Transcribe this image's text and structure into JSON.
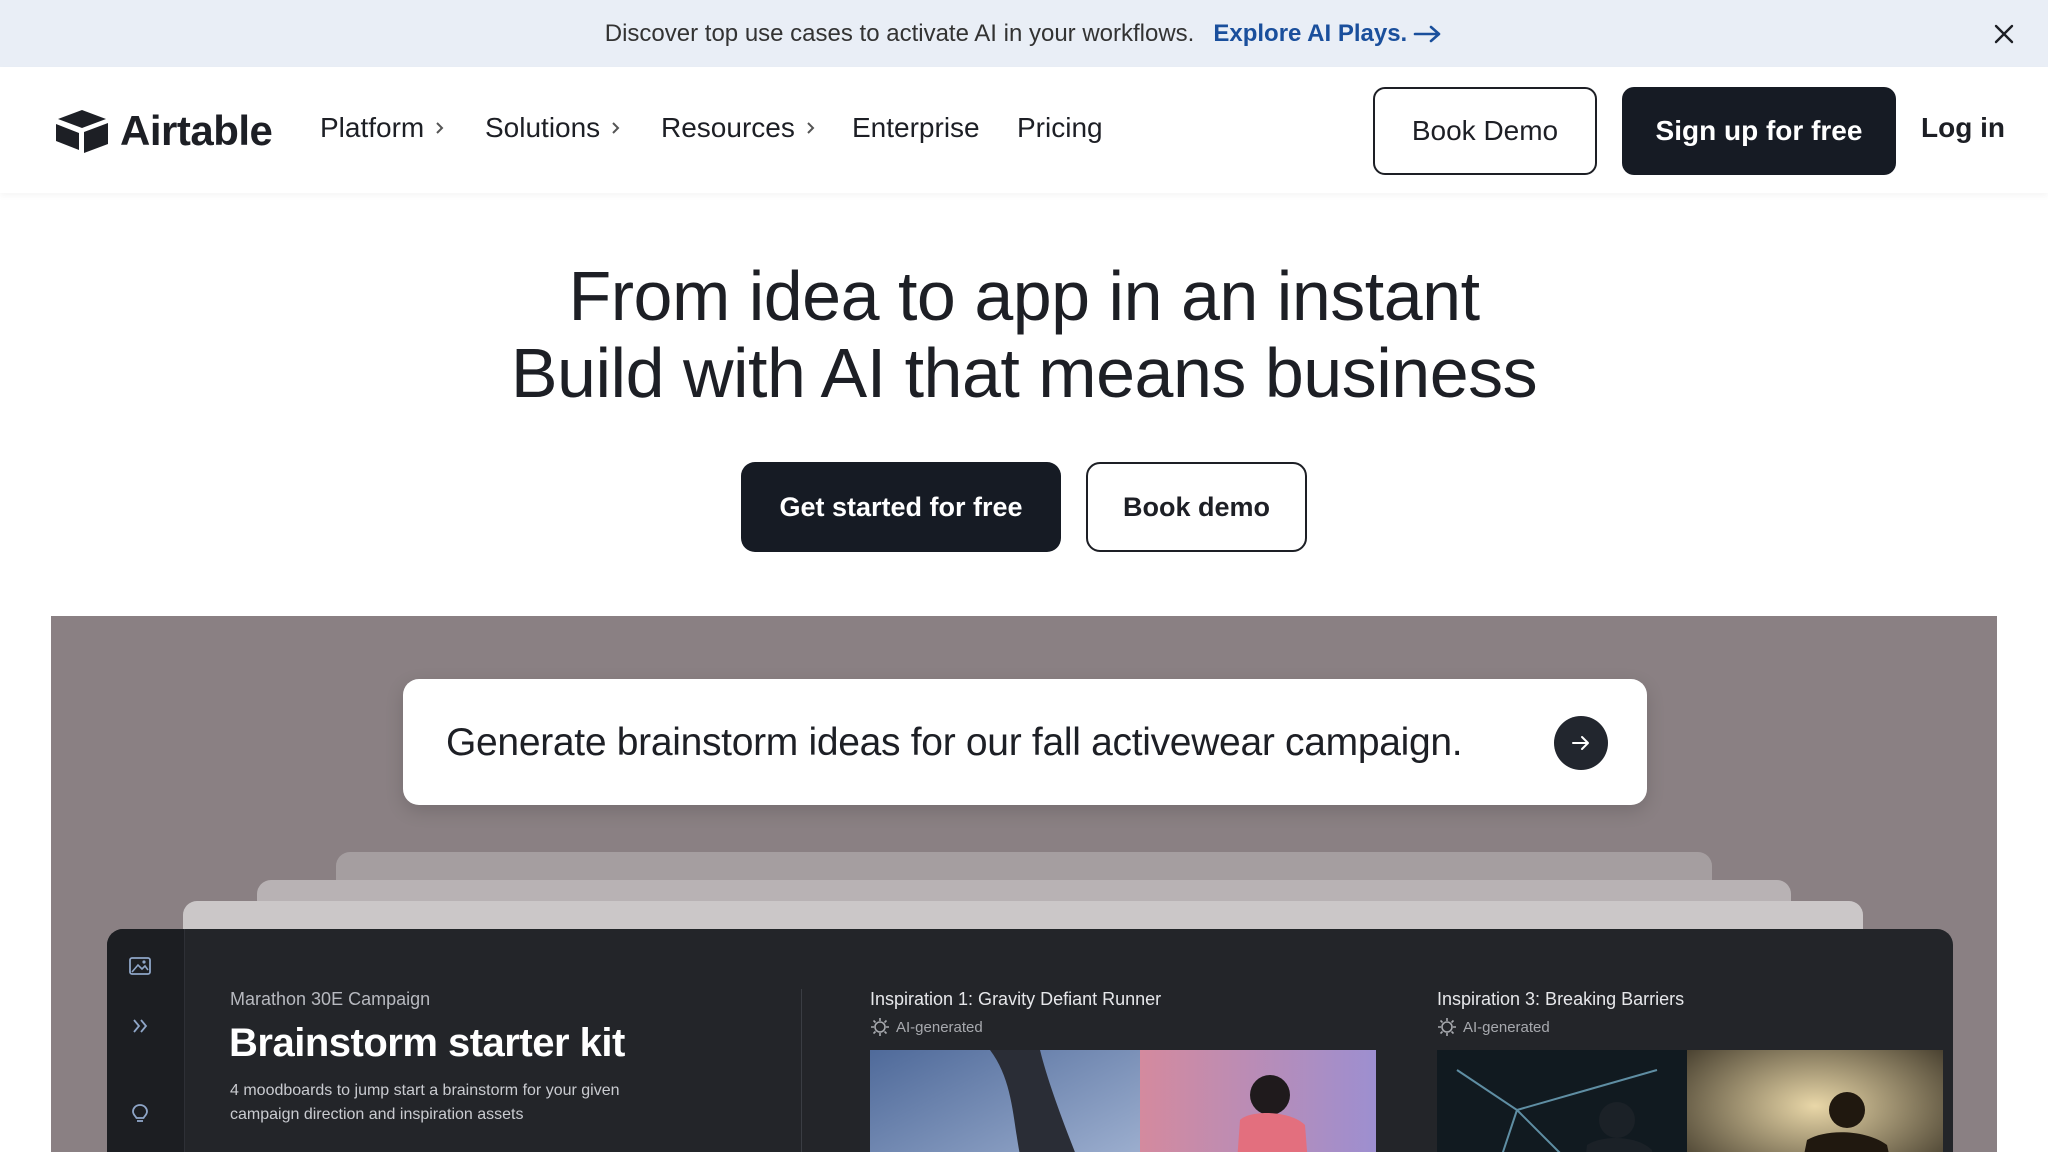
{
  "banner": {
    "text": "Discover top use cases to activate AI in your workflows.",
    "link_label": "Explore AI Plays.",
    "close_icon": "close-icon"
  },
  "nav": {
    "logo_text": "Airtable",
    "items": [
      {
        "label": "Platform",
        "has_chevron": true
      },
      {
        "label": "Solutions",
        "has_chevron": true
      },
      {
        "label": "Resources",
        "has_chevron": true
      },
      {
        "label": "Enterprise",
        "has_chevron": false
      },
      {
        "label": "Pricing",
        "has_chevron": false
      }
    ],
    "book_demo_label": "Book Demo",
    "signup_label": "Sign up for free",
    "login_label": "Log in"
  },
  "hero": {
    "title_line1": "From idea to app in an instant",
    "title_line2": "Build with AI that means business",
    "primary_cta": "Get started for free",
    "secondary_cta": "Book demo"
  },
  "showcase": {
    "prompt_text": "Generate brainstorm ideas for our fall activewear campaign.",
    "app": {
      "campaign_name": "Marathon 30E Campaign",
      "kit_title": "Brainstorm starter kit",
      "kit_description": "4 moodboards to jump start a brainstorm for your given campaign direction and inspiration assets",
      "inspirations": [
        {
          "title": "Inspiration 1: Gravity Defiant Runner",
          "tag": "AI-generated"
        },
        {
          "title": "Inspiration 3: Breaking Barriers",
          "tag": "AI-generated"
        }
      ]
    }
  },
  "colors": {
    "brand_dark": "#161b24",
    "banner_bg": "#e9eef6",
    "banner_link": "#1a4f9c",
    "showcase_bg": "#8a8083",
    "app_bg": "#232529"
  }
}
